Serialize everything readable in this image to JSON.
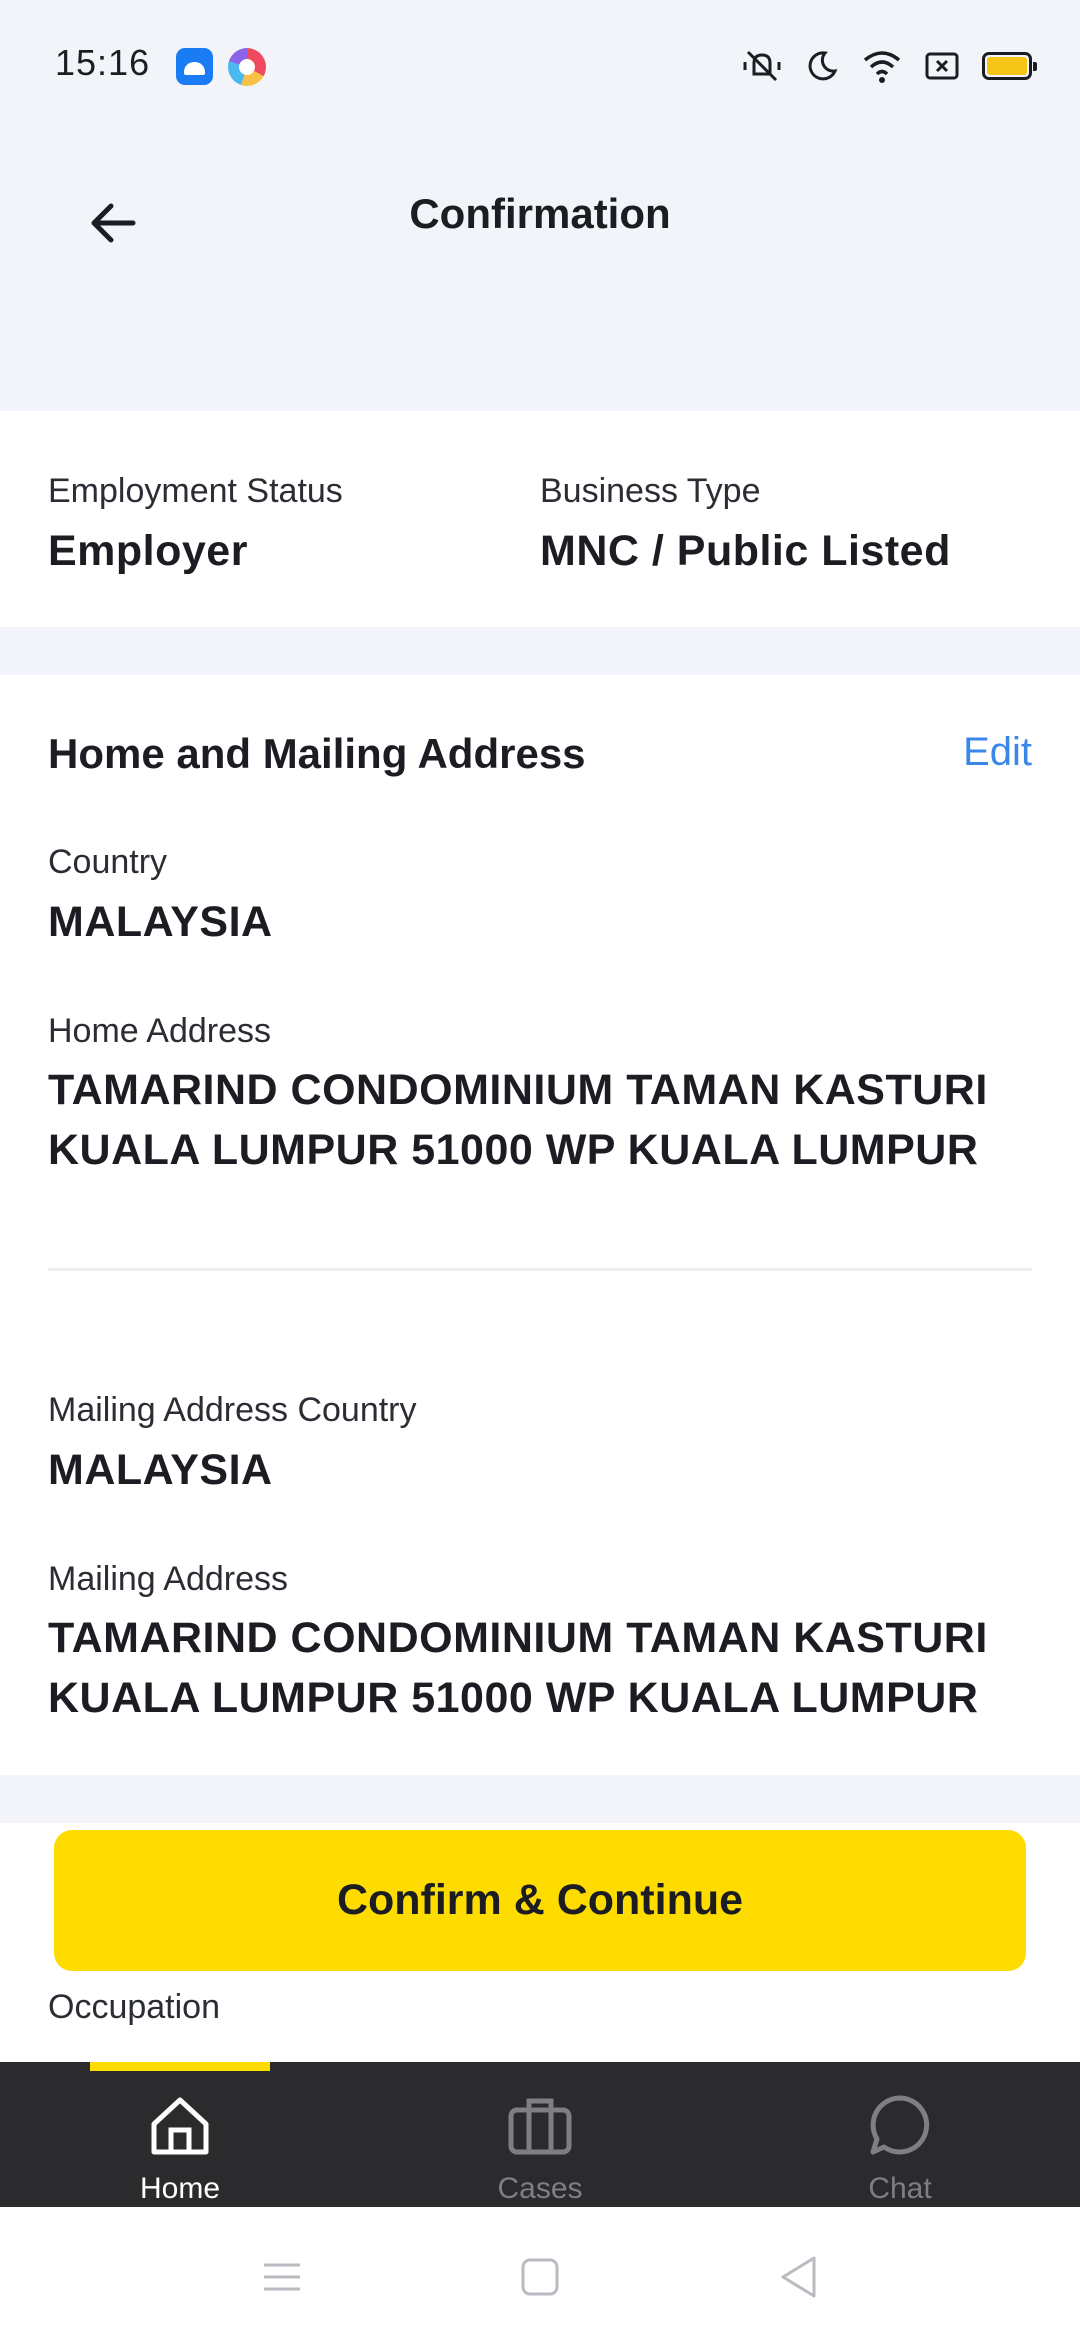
{
  "status_bar": {
    "time": "15:16",
    "icons": [
      "android-app-icon",
      "colorful-app-icon",
      "mute-vibrate-icon",
      "moon-icon",
      "wifi-icon",
      "sim-icon",
      "battery-icon"
    ],
    "battery_color": "#f5c518"
  },
  "header": {
    "title": "Confirmation",
    "back_icon": "arrow-left-icon"
  },
  "employment": {
    "employment_status_label": "Employment Status",
    "employment_status_value": "Employer",
    "business_type_label": "Business Type",
    "business_type_value": "MNC / Public Listed"
  },
  "address_section": {
    "heading": "Home and Mailing Address",
    "edit_label": "Edit",
    "country_label": "Country",
    "country_value": "MALAYSIA",
    "home_address_label": "Home Address",
    "home_address_line1": "TAMARIND CONDOMINIUM TAMAN KASTURI",
    "home_address_line2": "KUALA LUMPUR 51000 WP KUALA LUMPUR",
    "mailing_country_label": "Mailing Address Country",
    "mailing_country_value": "MALAYSIA",
    "mailing_address_label": "Mailing Address",
    "mailing_address_line1": "TAMARIND CONDOMINIUM TAMAN KASTURI",
    "mailing_address_line2": "KUALA LUMPUR 51000 WP KUALA LUMPUR"
  },
  "next_section": {
    "occupation_label": "Occupation"
  },
  "confirm_button": {
    "label": "Confirm & Continue",
    "color": "#ffdc00"
  },
  "bottom_nav": {
    "items": [
      {
        "label": "Home",
        "icon": "home-icon",
        "active": true
      },
      {
        "label": "Cases",
        "icon": "briefcase-icon",
        "active": false
      },
      {
        "label": "Chat",
        "icon": "chat-bubble-icon",
        "active": false
      }
    ],
    "active_color": "#ffdc00"
  },
  "system_nav": {
    "icons": [
      "menu-icon",
      "home-square-icon",
      "back-triangle-icon"
    ]
  },
  "colors": {
    "accent": "#ffdc00",
    "link": "#3a87e8",
    "background": "#f2f4f9",
    "nav_background": "#2b2b2e"
  }
}
